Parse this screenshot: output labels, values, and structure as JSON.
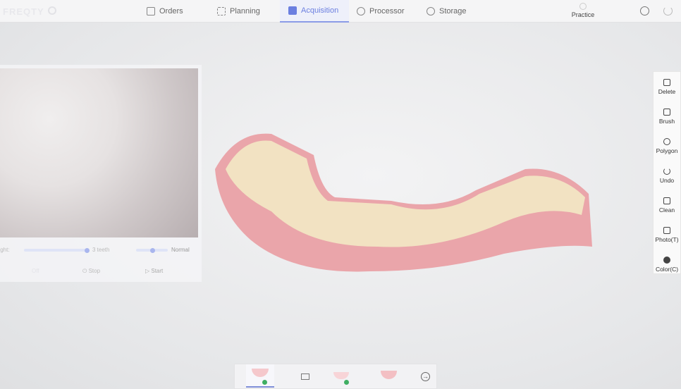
{
  "header": {
    "logo": "FREQTY",
    "tabs": [
      {
        "label": "Orders"
      },
      {
        "label": "Planning"
      },
      {
        "label": "Acquisition",
        "active": true
      },
      {
        "label": "Processor"
      },
      {
        "label": "Storage"
      }
    ],
    "practice": "Practice"
  },
  "preview": {
    "light_label": "Light:",
    "teeth_value": "3 teeth",
    "speed_value": "Normal",
    "light_progress": 0.95,
    "speed_progress": 0.5,
    "off": "Off",
    "stop": "Stop",
    "start": "Start"
  },
  "tools": [
    {
      "label": "Delete",
      "icon": "trash-icon"
    },
    {
      "label": "Brush",
      "icon": "brush-icon"
    },
    {
      "label": "Polygon",
      "icon": "polygon-icon"
    },
    {
      "label": "Undo",
      "icon": "undo-icon"
    },
    {
      "label": "Clean",
      "icon": "clean-icon"
    },
    {
      "label": "Photo(T)",
      "icon": "save-icon"
    },
    {
      "label": "Color(C)",
      "icon": "color-icon"
    }
  ],
  "colors": {
    "accent": "#6b7fe0",
    "check": "#3fae62"
  }
}
